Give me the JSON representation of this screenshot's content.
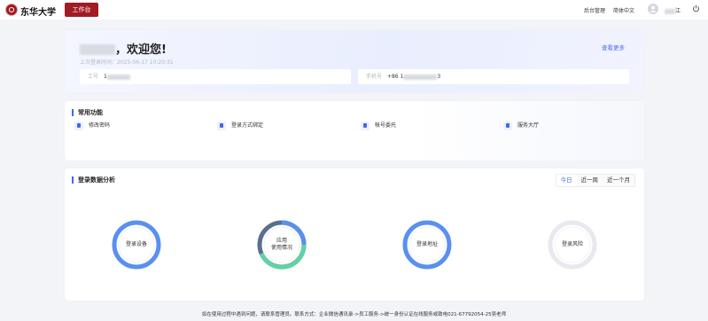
{
  "header": {
    "brand": "东华大学",
    "workbench_label": "工作台",
    "admin_label": "后台管理",
    "language_label": "简体中文",
    "username_suffix": "江"
  },
  "welcome": {
    "greeting": "，欢迎您!",
    "last_login": "上次登录时间：2025-06-17 10:20:31",
    "see_more": "查看更多",
    "employee_label": "工号",
    "employee_value": "1",
    "phone_label": "手机号",
    "phone_prefix": "+86 1",
    "phone_suffix": "3"
  },
  "common_functions": {
    "title": "常用功能",
    "items": [
      {
        "label": "修改密码",
        "icon": "lock-icon"
      },
      {
        "label": "登录方式绑定",
        "icon": "link-icon"
      },
      {
        "label": "帐号委托",
        "icon": "user-share-icon"
      },
      {
        "label": "服务大厅",
        "icon": "service-hall-icon"
      }
    ]
  },
  "analysis": {
    "title": "登录数据分析",
    "tabs": [
      "今日",
      "近一周",
      "近一个月"
    ],
    "active_tab": "今日",
    "donuts": [
      {
        "label": "登录设备",
        "color": "#5b8ff0"
      },
      {
        "label_line1": "应用",
        "label_line2": "使用情况",
        "colors": [
          "#5b8ff0",
          "#5fd3a3",
          "#5a6f8f"
        ]
      },
      {
        "label": "登录地址",
        "color": "#5b8ff0"
      },
      {
        "label": "登录风险",
        "color": "#e7e9ef"
      }
    ]
  },
  "footer": {
    "text": "如在使用过程中遇到问题，请联系管理员。联系方式：企业微信通讯录->员工服务->统一身份认证在线服务或致电021-67792054-25吴老师"
  }
}
